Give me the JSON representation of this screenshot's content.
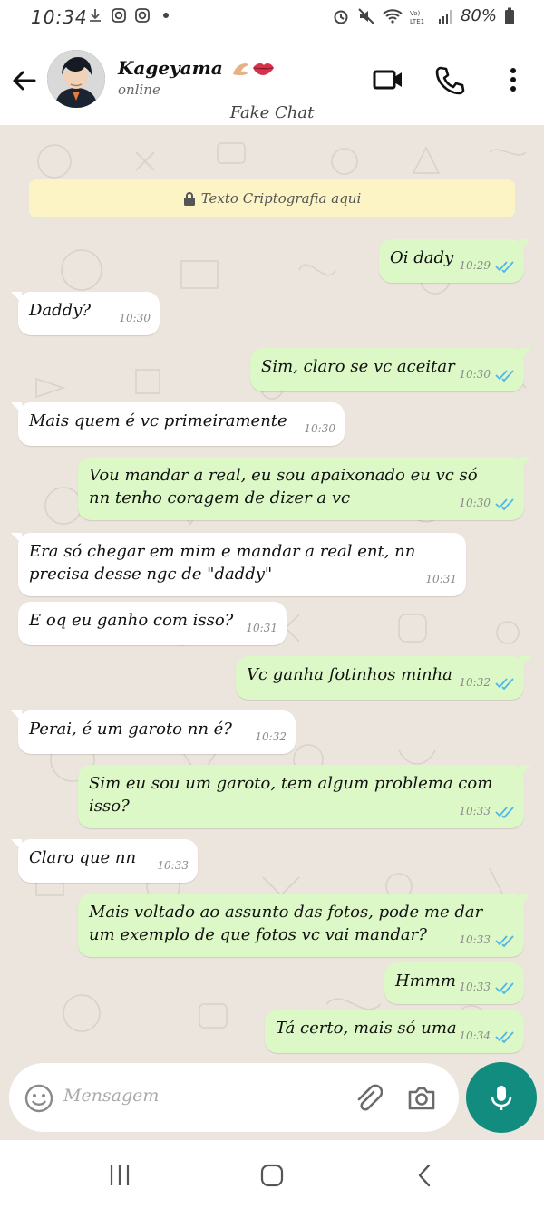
{
  "status_bar": {
    "time": "10:34",
    "battery": "80%"
  },
  "header": {
    "contact_name": "Kageyama",
    "status": "online",
    "watermark": "Fake Chat"
  },
  "encryption_notice": "Texto Criptografia aqui",
  "messages": [
    {
      "dir": "out",
      "text": "Oi dady",
      "time": "10:29",
      "read": true
    },
    {
      "dir": "in",
      "text": "Daddy?",
      "time": "10:30"
    },
    {
      "dir": "out",
      "text": "Sim, claro se vc aceitar",
      "time": "10:30",
      "read": true
    },
    {
      "dir": "in",
      "text": "Mais quem é vc primeiramente",
      "time": "10:30"
    },
    {
      "dir": "out",
      "text": "Vou mandar a real, eu sou apaixonado eu vc só nn tenho coragem de dizer a vc",
      "time": "10:30",
      "read": true
    },
    {
      "dir": "in",
      "text": "Era só chegar em mim e mandar a real ent, nn precisa desse ngc de \"daddy\"",
      "time": "10:31"
    },
    {
      "dir": "in",
      "text": "E oq eu ganho com isso?",
      "time": "10:31"
    },
    {
      "dir": "out",
      "text": "Vc ganha fotinhos minha",
      "time": "10:32",
      "read": true
    },
    {
      "dir": "in",
      "text": "Perai, é um garoto nn é?",
      "time": "10:32"
    },
    {
      "dir": "out",
      "text": "Sim eu sou um garoto, tem algum problema com isso?",
      "time": "10:33",
      "read": true
    },
    {
      "dir": "in",
      "text": "Claro que nn",
      "time": "10:33"
    },
    {
      "dir": "out",
      "text": "Mais voltado ao assunto das fotos, pode me dar um exemplo de que fotos vc vai mandar?",
      "time": "10:33",
      "read": true
    },
    {
      "dir": "out",
      "text": "Hmmm",
      "time": "10:33",
      "read": true
    },
    {
      "dir": "out",
      "text": "Tá certo, mais só uma",
      "time": "10:34",
      "read": true
    }
  ],
  "input": {
    "placeholder": "Mensagem"
  },
  "colors": {
    "chat_bg": "#ece5dd",
    "outgoing": "#dcf8c6",
    "incoming": "#ffffff",
    "accent": "#128c7e",
    "read_ticks": "#4fb6ec"
  },
  "icons": [
    "back-arrow-icon",
    "video-call-icon",
    "phone-icon",
    "more-vert-icon",
    "lock-icon",
    "emoji-icon",
    "attach-icon",
    "camera-icon",
    "mic-icon",
    "recent-apps-icon",
    "home-icon",
    "nav-back-icon"
  ]
}
